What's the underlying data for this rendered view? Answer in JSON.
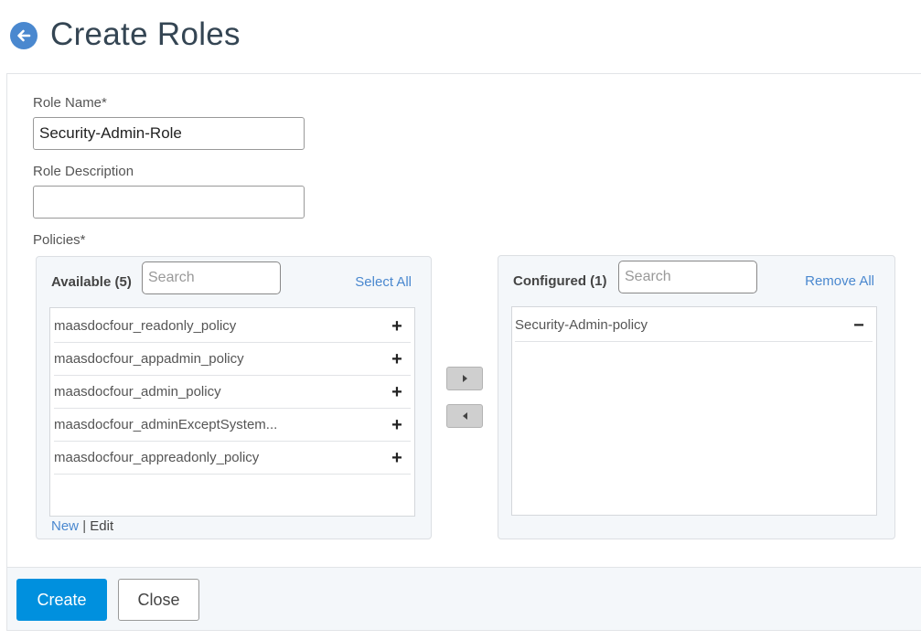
{
  "header": {
    "title": "Create Roles",
    "back_icon": "arrow-left-circle-icon"
  },
  "form": {
    "role_name": {
      "label": "Role Name*",
      "value": "Security-Admin-Role",
      "placeholder": ""
    },
    "role_description": {
      "label": "Role Description",
      "value": "",
      "placeholder": ""
    },
    "policies_label": "Policies*"
  },
  "available": {
    "title": "Available (5)",
    "search_placeholder": "Search",
    "select_all_label": "Select All",
    "items": [
      {
        "label": "maasdocfour_readonly_policy",
        "action": "+"
      },
      {
        "label": "maasdocfour_appadmin_policy",
        "action": "+"
      },
      {
        "label": "maasdocfour_admin_policy",
        "action": "+"
      },
      {
        "label": "maasdocfour_adminExceptSystem...",
        "action": "+"
      },
      {
        "label": "maasdocfour_appreadonly_policy",
        "action": "+"
      }
    ],
    "new_label": "New",
    "separator": "|",
    "edit_label": "Edit"
  },
  "transfer": {
    "add_icon": "triangle-right-icon",
    "remove_icon": "triangle-left-icon"
  },
  "configured": {
    "title": "Configured (1)",
    "search_placeholder": "Search",
    "remove_all_label": "Remove All",
    "items": [
      {
        "label": "Security-Admin-policy",
        "action": "−"
      }
    ]
  },
  "footer": {
    "create_label": "Create",
    "close_label": "Close"
  },
  "colors": {
    "accent": "#0090de",
    "link": "#4a88cf",
    "panel_bg": "#f4f7fa"
  }
}
